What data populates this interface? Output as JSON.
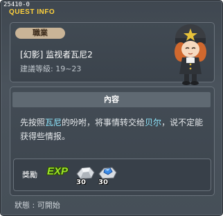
{
  "window": {
    "id_label": "25410-0",
    "title": "QUEST INFO"
  },
  "quest": {
    "job_tag": "職業",
    "name": "[幻影] 监视者瓦尼2",
    "level": "建議等級: 19~23"
  },
  "content": {
    "header": "內容",
    "desc_1": "先按照",
    "desc_hl_1": "瓦尼",
    "desc_2": "的吩咐，将事情转交给",
    "desc_hl_2": "贝尔",
    "desc_3": "，说不定能获得些情报。"
  },
  "reward": {
    "label": "獎勵",
    "exp_label": "EXP",
    "items": [
      {
        "icon": "silver-ore-icon",
        "qty": "30"
      },
      {
        "icon": "blue-crystal-ore-icon",
        "qty": "30"
      }
    ]
  },
  "status": {
    "text": "狀態 : 可開始"
  },
  "colors": {
    "title": "#ffd23c",
    "highlight": "#8ee8ff",
    "exp": "#9ee62a"
  }
}
